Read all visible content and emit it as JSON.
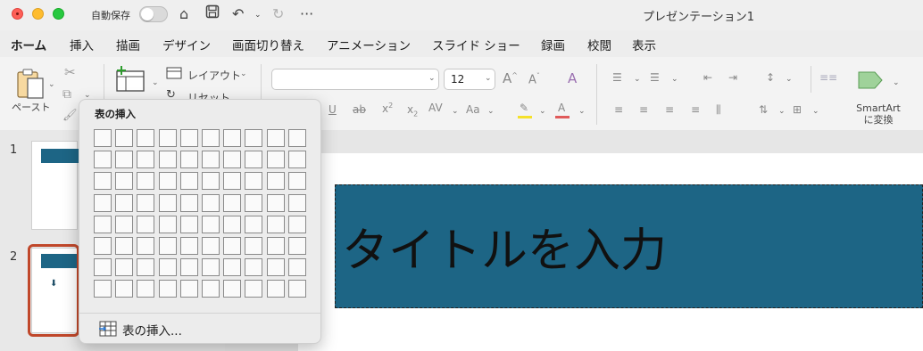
{
  "titlebar": {
    "autosave_label": "自動保存",
    "doc_title": "プレゼンテーション1",
    "icons": [
      "home-icon",
      "save-icon",
      "undo-icon",
      "redo-icon",
      "more-icon"
    ]
  },
  "tabs": [
    "ホーム",
    "挿入",
    "描画",
    "デザイン",
    "画面切り替え",
    "アニメーション",
    "スライド ショー",
    "録画",
    "校閲",
    "表示"
  ],
  "ribbon": {
    "paste_label": "ペースト",
    "layout_label": "レイアウト",
    "reset_label": "リセット",
    "font_name": "",
    "font_size": "12",
    "smartart_label_line1": "SmartArt",
    "smartart_label_line2": "に変換"
  },
  "slides": {
    "numbers": [
      "1",
      "2"
    ]
  },
  "slide": {
    "title_placeholder": "タイトルを入力"
  },
  "popup": {
    "title": "表の挿入",
    "rows": 8,
    "cols": 10,
    "action_label": "表の挿入..."
  },
  "colors": {
    "accent": "#c43e1c",
    "slide_title_fill": "#1d6585"
  }
}
